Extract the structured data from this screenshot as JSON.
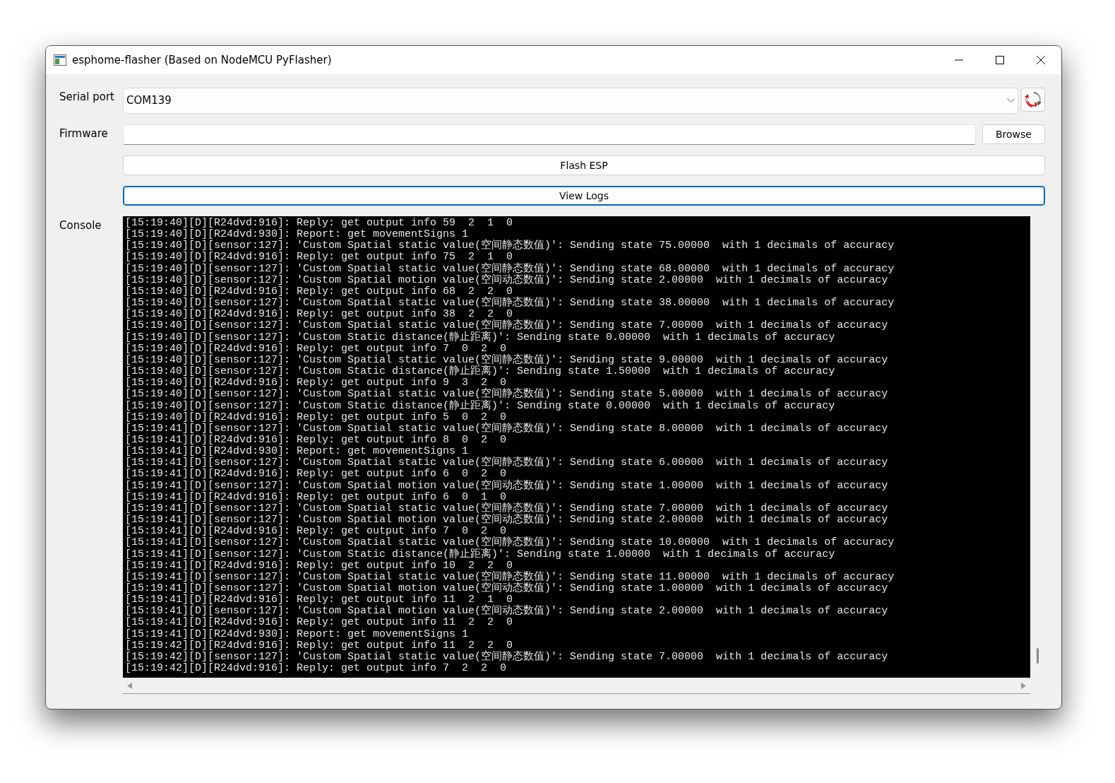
{
  "window": {
    "title": "esphome-flasher (Based on NodeMCU PyFlasher)"
  },
  "serial_port": {
    "label": "Serial port",
    "value": "COM139"
  },
  "firmware": {
    "label": "Firmware",
    "browse_button": "Browse"
  },
  "buttons": [
    {
      "label": "Flash ESP",
      "focused": false
    },
    {
      "label": "View Logs",
      "focused": true
    }
  ],
  "console": {
    "label": "Console",
    "lines": [
      "[15:19:40][D][R24dvd:916]: Reply: get output info 59  2  1  0",
      "[15:19:40][D][R24dvd:930]: Report: get movementSigns 1",
      "[15:19:40][D][sensor:127]: 'Custom Spatial static value(空间静态数值)': Sending state 75.00000  with 1 decimals of accuracy",
      "[15:19:40][D][R24dvd:916]: Reply: get output info 75  2  1  0",
      "[15:19:40][D][sensor:127]: 'Custom Spatial static value(空间静态数值)': Sending state 68.00000  with 1 decimals of accuracy",
      "[15:19:40][D][sensor:127]: 'Custom Spatial motion value(空间动态数值)': Sending state 2.00000  with 1 decimals of accuracy",
      "[15:19:40][D][R24dvd:916]: Reply: get output info 68  2  2  0",
      "[15:19:40][D][sensor:127]: 'Custom Spatial static value(空间静态数值)': Sending state 38.00000  with 1 decimals of accuracy",
      "[15:19:40][D][R24dvd:916]: Reply: get output info 38  2  2  0",
      "[15:19:40][D][sensor:127]: 'Custom Spatial static value(空间静态数值)': Sending state 7.00000  with 1 decimals of accuracy",
      "[15:19:40][D][sensor:127]: 'Custom Static distance(静止距离)': Sending state 0.00000  with 1 decimals of accuracy",
      "[15:19:40][D][R24dvd:916]: Reply: get output info 7  0  2  0",
      "[15:19:40][D][sensor:127]: 'Custom Spatial static value(空间静态数值)': Sending state 9.00000  with 1 decimals of accuracy",
      "[15:19:40][D][sensor:127]: 'Custom Static distance(静止距离)': Sending state 1.50000  with 1 decimals of accuracy",
      "[15:19:40][D][R24dvd:916]: Reply: get output info 9  3  2  0",
      "[15:19:40][D][sensor:127]: 'Custom Spatial static value(空间静态数值)': Sending state 5.00000  with 1 decimals of accuracy",
      "[15:19:40][D][sensor:127]: 'Custom Static distance(静止距离)': Sending state 0.00000  with 1 decimals of accuracy",
      "[15:19:40][D][R24dvd:916]: Reply: get output info 5  0  2  0",
      "[15:19:41][D][sensor:127]: 'Custom Spatial static value(空间静态数值)': Sending state 8.00000  with 1 decimals of accuracy",
      "[15:19:41][D][R24dvd:916]: Reply: get output info 8  0  2  0",
      "[15:19:41][D][R24dvd:930]: Report: get movementSigns 1",
      "[15:19:41][D][sensor:127]: 'Custom Spatial static value(空间静态数值)': Sending state 6.00000  with 1 decimals of accuracy",
      "[15:19:41][D][R24dvd:916]: Reply: get output info 6  0  2  0",
      "[15:19:41][D][sensor:127]: 'Custom Spatial motion value(空间动态数值)': Sending state 1.00000  with 1 decimals of accuracy",
      "[15:19:41][D][R24dvd:916]: Reply: get output info 6  0  1  0",
      "[15:19:41][D][sensor:127]: 'Custom Spatial static value(空间静态数值)': Sending state 7.00000  with 1 decimals of accuracy",
      "[15:19:41][D][sensor:127]: 'Custom Spatial motion value(空间动态数值)': Sending state 2.00000  with 1 decimals of accuracy",
      "[15:19:41][D][R24dvd:916]: Reply: get output info 7  0  2  0",
      "[15:19:41][D][sensor:127]: 'Custom Spatial static value(空间静态数值)': Sending state 10.00000  with 1 decimals of accuracy",
      "[15:19:41][D][sensor:127]: 'Custom Static distance(静止距离)': Sending state 1.00000  with 1 decimals of accuracy",
      "[15:19:41][D][R24dvd:916]: Reply: get output info 10  2  2  0",
      "[15:19:41][D][sensor:127]: 'Custom Spatial static value(空间静态数值)': Sending state 11.00000  with 1 decimals of accuracy",
      "[15:19:41][D][sensor:127]: 'Custom Spatial motion value(空间动态数值)': Sending state 1.00000  with 1 decimals of accuracy",
      "[15:19:41][D][R24dvd:916]: Reply: get output info 11  2  1  0",
      "[15:19:41][D][sensor:127]: 'Custom Spatial motion value(空间动态数值)': Sending state 2.00000  with 1 decimals of accuracy",
      "[15:19:41][D][R24dvd:916]: Reply: get output info 11  2  2  0",
      "[15:19:41][D][R24dvd:930]: Report: get movementSigns 1",
      "[15:19:42][D][R24dvd:916]: Reply: get output info 11  2  2  0",
      "[15:19:42][D][sensor:127]: 'Custom Spatial static value(空间静态数值)': Sending state 7.00000  with 1 decimals of accuracy",
      "[15:19:42][D][R24dvd:916]: Reply: get output info 7  2  2  0"
    ]
  }
}
